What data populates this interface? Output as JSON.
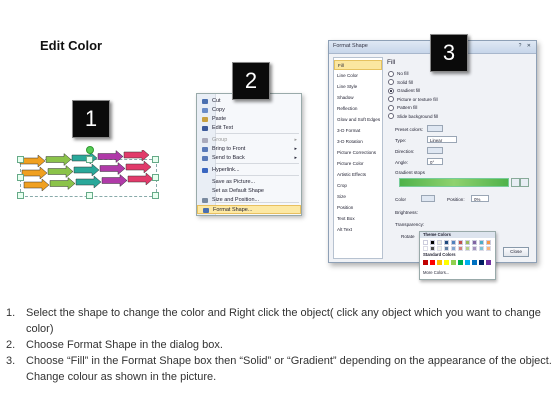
{
  "title": "Edit Color",
  "badges": [
    "1",
    "2",
    "3"
  ],
  "context_menu": {
    "items": [
      {
        "label": "Cut",
        "icon": "scissors-icon",
        "color": "#4a6fb0",
        "disabled": false,
        "arrow": ""
      },
      {
        "label": "Copy",
        "icon": "copy-icon",
        "color": "#6a8cc8",
        "disabled": false,
        "arrow": ""
      },
      {
        "label": "Paste",
        "icon": "paste-icon",
        "color": "#c8a040",
        "disabled": false,
        "arrow": ""
      },
      {
        "label": "Edit Text",
        "icon": "edit-text-icon",
        "color": "#3c5a9a",
        "disabled": false,
        "arrow": ""
      },
      {
        "label": "Group",
        "icon": "group-icon",
        "color": "#aab",
        "disabled": true,
        "arrow": "▸"
      },
      {
        "label": "Bring to Front",
        "icon": "bring-front-icon",
        "color": "#5a7ab8",
        "disabled": false,
        "arrow": "▸"
      },
      {
        "label": "Send to Back",
        "icon": "send-back-icon",
        "color": "#5a7ab8",
        "disabled": false,
        "arrow": "▸"
      },
      {
        "label": "Hyperlink...",
        "icon": "hyperlink-icon",
        "color": "#3a66c0",
        "disabled": false,
        "arrow": ""
      },
      {
        "label": "Save as Picture...",
        "icon": "",
        "color": "",
        "disabled": false,
        "arrow": ""
      },
      {
        "label": "Set as Default Shape",
        "icon": "",
        "color": "",
        "disabled": false,
        "arrow": ""
      },
      {
        "label": "Size and Position...",
        "icon": "size-icon",
        "color": "#7a8aa0",
        "disabled": false,
        "arrow": ""
      },
      {
        "label": "Format Shape...",
        "icon": "format-shape-icon",
        "color": "#4a6fb0",
        "disabled": false,
        "arrow": "",
        "highlighted": true
      }
    ]
  },
  "dialog": {
    "title": "Format Shape",
    "title_buttons": "? ✕",
    "nav": [
      "Fill",
      "Line Color",
      "Line Style",
      "Shadow",
      "Reflection",
      "Glow and Soft Edges",
      "3-D Format",
      "3-D Rotation",
      "Picture Corrections",
      "Picture Color",
      "Artistic Effects",
      "Crop",
      "Size",
      "Position",
      "Text Box",
      "Alt Text"
    ],
    "section": "Fill",
    "fill_options": [
      {
        "label": "No fill",
        "checked": false
      },
      {
        "label": "Solid fill",
        "checked": false
      },
      {
        "label": "Gradient fill",
        "checked": true
      },
      {
        "label": "Picture or texture fill",
        "checked": false
      },
      {
        "label": "Pattern fill",
        "checked": false
      },
      {
        "label": "Slide background fill",
        "checked": false
      }
    ],
    "preset_label": "Preset colors:",
    "type_label": "Type:",
    "type_value": "Linear",
    "direction_label": "Direction:",
    "angle_label": "Angle:",
    "angle_value": "0°",
    "stops_label": "Gradient stops",
    "color_label": "Color",
    "position_label": "Position:",
    "position_value": "0%",
    "brightness_label": "Brightness:",
    "transparency_label": "Transparency:",
    "rotate_label": "Rotate",
    "close_label": "Close"
  },
  "picker": {
    "theme_label": "Theme Colors",
    "standard_label": "Standard Colors",
    "more_label": "More Colors..."
  },
  "instructions": [
    {
      "num": "1.",
      "text": "Select the shape to change the color and Right click the object( click any object which you want to change color)"
    },
    {
      "num": "2.",
      "text": "Choose Format Shape in the dialog box."
    },
    {
      "num": "3.",
      "text": "Choose “Fill” in the Format Shape box then “Solid” or “Gradient” depending on the appearance of the object. Change colour as shown in the picture."
    }
  ],
  "arrow_colors": [
    "#f0a020",
    "#8bc34a",
    "#2aa89a",
    "#b03aa8",
    "#e23a6a"
  ]
}
